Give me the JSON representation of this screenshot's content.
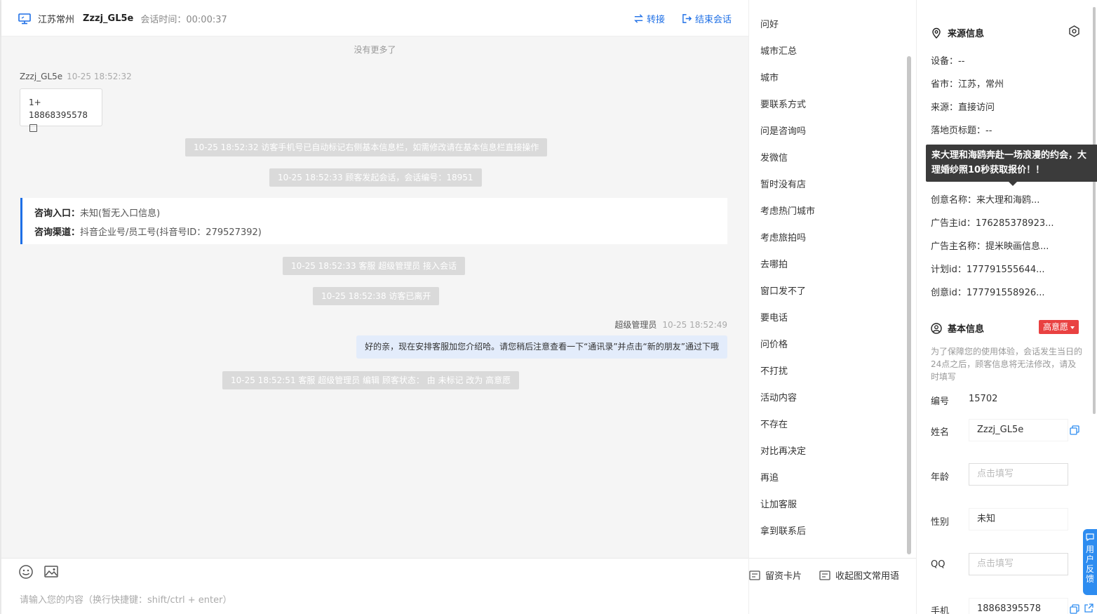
{
  "header": {
    "region": "江苏常州",
    "visitor": "Zzzj_GL5e",
    "session_time_label": "会话时间：",
    "session_time": "00:00:37",
    "transfer": "转接",
    "end_session": "结束会话"
  },
  "messages": {
    "no_more": "没有更多了",
    "visitor_name": "Zzzj_GL5e",
    "visitor_time": "10-25 18:52:32",
    "visitor_line1": "1+",
    "visitor_line2": "18868395578",
    "sys1": "10-25 18:52:32 访客手机号已自动标记右侧基本信息栏，如需修改请在基本信息栏直接操作",
    "sys2": "10-25 18:52:33 顾客发起会话，会话编号：18951",
    "entry_label": "咨询入口：",
    "entry_value": "未知(暂无入口信息)",
    "channel_label": "咨询渠道：",
    "channel_value": "抖音企业号/员工号(抖音号ID：279527392)",
    "sys3": "10-25 18:52:33 客服 超级管理员 接入会话",
    "sys4": "10-25 18:52:38 访客已离开",
    "agent_name": "超级管理员",
    "agent_time": "10-25 18:52:49",
    "agent_text": "好的亲，现在安排客服加您介绍哈。请您稍后注意查看一下“通讯录”并点击“新的朋友”通过下哦",
    "sys5": "10-25 18:52:51 客服 超级管理员 编辑 顾客状态： 由 未标记 改为 高意愿"
  },
  "composer": {
    "placeholder": "请输入您的内容（换行快捷键：shift/ctrl + enter）"
  },
  "quick_phrases": [
    "问好",
    "城市汇总",
    "城市",
    "要联系方式",
    "问是咨询吗",
    "发微信",
    "暂时没有店",
    "考虑热门城市",
    "考虑旅拍吗",
    "去哪拍",
    "窗口发不了",
    "要电话",
    "问价格",
    "不打扰",
    "活动内容",
    "不存在",
    "对比再决定",
    "再追",
    "让加客服",
    "拿到联系后"
  ],
  "quick_bottom": {
    "card": "留资卡片",
    "collapse": "收起图文常用语"
  },
  "source": {
    "title": "来源信息",
    "device": "设备：--",
    "province": "省市：江苏，常州",
    "from": "来源：直接访问",
    "landing": "落地页标题：--",
    "tooltip": "来大理和海鸥奔赴一场浪漫的约会，大理婚纱照10秒获取报价！！",
    "creative_name": "创意名称：来大理和海鸥...",
    "advertiser_id": "广告主id：176285378923...",
    "advertiser_name": "广告主名称：提米映画信息...",
    "plan_id": "计划id：177791555644...",
    "creative_id": "创意id：177791558926..."
  },
  "basic": {
    "title": "基本信息",
    "intent": "高意愿",
    "notice": "为了保障您的使用体验，会话发生当日的24点之后，顾客信息将无法修改，请及时填写",
    "id_label": "编号",
    "id_value": "15702",
    "name_label": "姓名",
    "name_value": "Zzzj_GL5e",
    "age_label": "年龄",
    "age_placeholder": "点击填写",
    "gender_label": "性别",
    "gender_value": "未知",
    "qq_label": "QQ",
    "qq_placeholder": "点击填写",
    "phone_label": "手机",
    "phone_value": "18868395578"
  },
  "feedback": "用户反馈",
  "colors": {
    "accent": "#1e6fe6",
    "intent_red": "#e94141",
    "sys_bg": "#dadada",
    "agent_bubble": "#e3ecfb"
  }
}
